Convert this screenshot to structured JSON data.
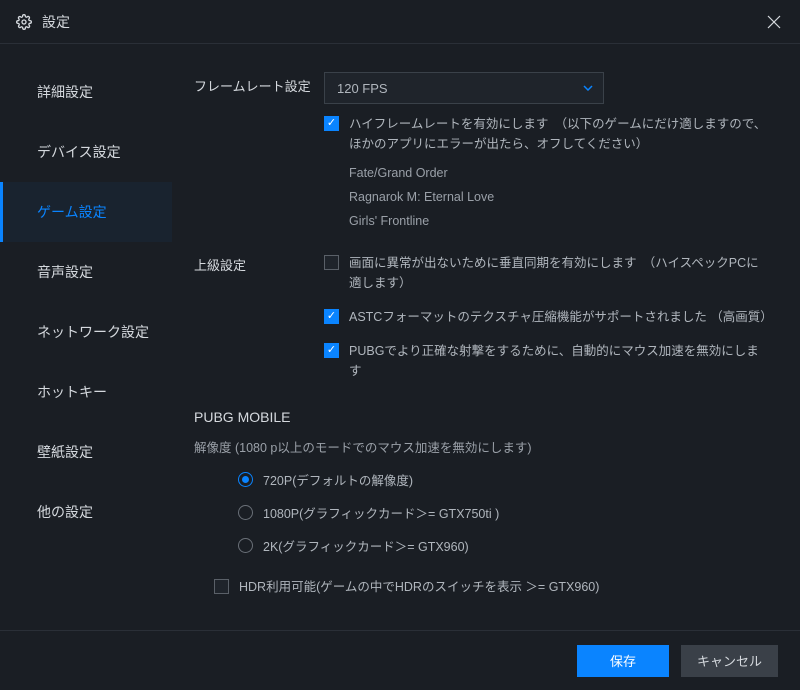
{
  "title": "設定",
  "sidebar": {
    "items": [
      {
        "label": "詳細設定"
      },
      {
        "label": "デバイス設定"
      },
      {
        "label": "ゲーム設定"
      },
      {
        "label": "音声設定"
      },
      {
        "label": "ネットワーク設定"
      },
      {
        "label": "ホットキー"
      },
      {
        "label": "壁紙設定"
      },
      {
        "label": "他の設定"
      }
    ],
    "active_index": 2
  },
  "framerate": {
    "label": "フレームレート設定",
    "value": "120 FPS",
    "hf_enabled": true,
    "hf_text": "ハイフレームレートを有効にします　（以下のゲームにだけ適しますので、ほかのアプリにエラーが出たら、オフしてください）",
    "games": [
      "Fate/Grand Order",
      "Ragnarok M: Eternal Love",
      "Girls' Frontline"
    ]
  },
  "advanced": {
    "label": "上級設定",
    "vsync_enabled": false,
    "vsync_text": "画面に異常が出ないために垂直同期を有効にします　（ハイスペックPCに適します）",
    "astc_enabled": true,
    "astc_text": "ASTCフォーマットのテクスチャ圧縮機能がサポートされました （高画質）",
    "mouse_enabled": true,
    "mouse_text": "PUBGでより正確な射撃をするために、自動的にマウス加速を無効にします"
  },
  "pubg": {
    "title": "PUBG MOBILE",
    "note": "解像度 (1080 p以上のモードでのマウス加速を無効にします)",
    "options": [
      {
        "label": "720P(デフォルトの解像度)",
        "selected": true
      },
      {
        "label": "1080P(グラフィックカード＞= GTX750ti )",
        "selected": false
      },
      {
        "label": "2K(グラフィックカード＞= GTX960)",
        "selected": false
      }
    ],
    "hdr_enabled": false,
    "hdr_text": "HDR利用可能(ゲームの中でHDRのスイッチを表示 ＞= GTX960)"
  },
  "footer": {
    "save": "保存",
    "cancel": "キャンセル"
  }
}
